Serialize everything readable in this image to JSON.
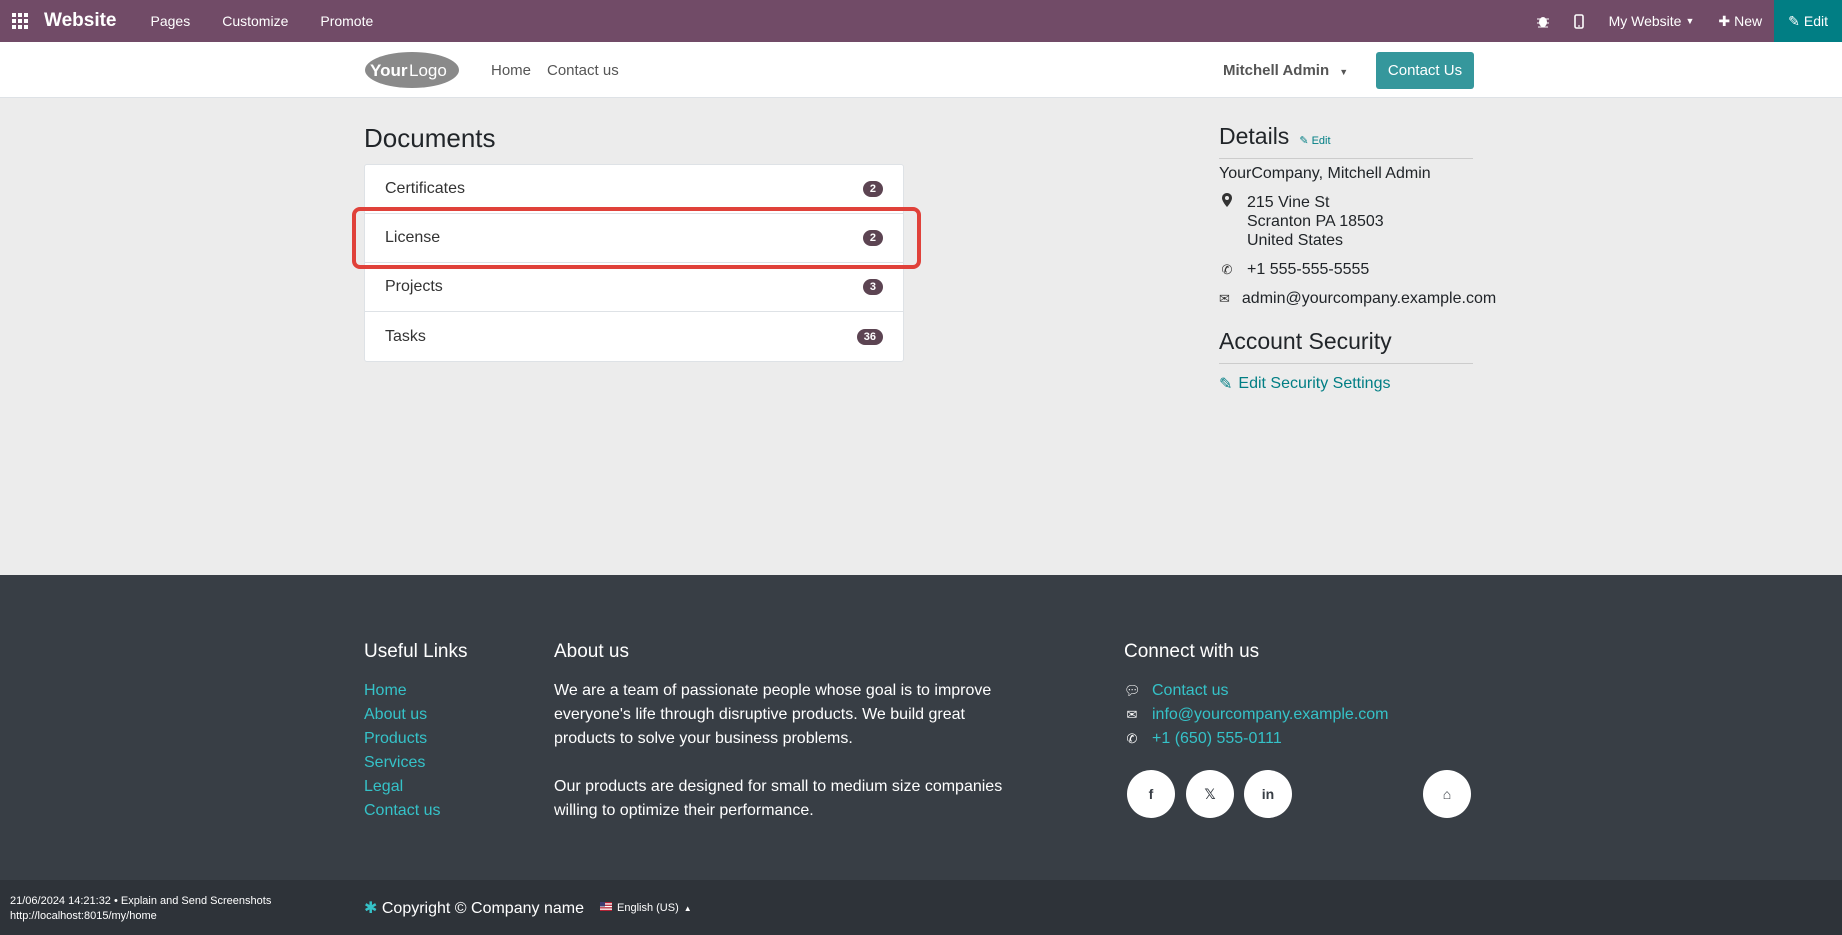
{
  "adminbar": {
    "brand": "Website",
    "menus": [
      "Pages",
      "Customize",
      "Promote"
    ],
    "bug_icon": "bug-icon",
    "mobile_icon": "mobile-icon",
    "site_selector": "My Website",
    "new_label": "New",
    "edit_label": "Edit",
    "bg_color": "#714b67",
    "edit_color": "#017e84"
  },
  "header": {
    "logo_part1": "Your",
    "logo_part2": "Logo",
    "nav": [
      "Home",
      "Contact us"
    ],
    "user": "Mitchell Admin",
    "contact_button": "Contact Us"
  },
  "documents": {
    "title": "Documents",
    "items": [
      {
        "label": "Certificates",
        "count": "2"
      },
      {
        "label": "License",
        "count": "2"
      },
      {
        "label": "Projects",
        "count": "3"
      },
      {
        "label": "Tasks",
        "count": "36"
      }
    ]
  },
  "details": {
    "title": "Details",
    "edit_label": "Edit",
    "company": "YourCompany, Mitchell Admin",
    "address_line1": "215 Vine St",
    "address_line2": "Scranton PA 18503",
    "address_line3": "United States",
    "phone": "+1 555-555-5555",
    "email": "admin@yourcompany.example.com"
  },
  "security": {
    "title": "Account Security",
    "link": "Edit Security Settings"
  },
  "footer": {
    "useful_links_title": "Useful Links",
    "useful_links": [
      "Home",
      "About us",
      "Products",
      "Services",
      "Legal",
      "Contact us"
    ],
    "about_title": "About us",
    "about_p1": "We are a team of passionate people whose goal is to improve everyone's life through disruptive products. We build great products to solve your business problems.",
    "about_p2": "Our products are designed for small to medium size companies willing to optimize their performance.",
    "connect_title": "Connect with us",
    "connect_contact": "Contact us",
    "connect_email": "info@yourcompany.example.com",
    "connect_phone": "+1 (650) 555-0111",
    "social": [
      "f",
      "𝕏",
      "in",
      "⌂"
    ],
    "link_color": "#35c2c8"
  },
  "bottom": {
    "copyright": "Copyright © Company name",
    "language": "English (US)",
    "stamp_line1": "21/06/2024 14:21:32 • Explain and Send Screenshots",
    "stamp_line2": "http://localhost:8015/my/home"
  }
}
